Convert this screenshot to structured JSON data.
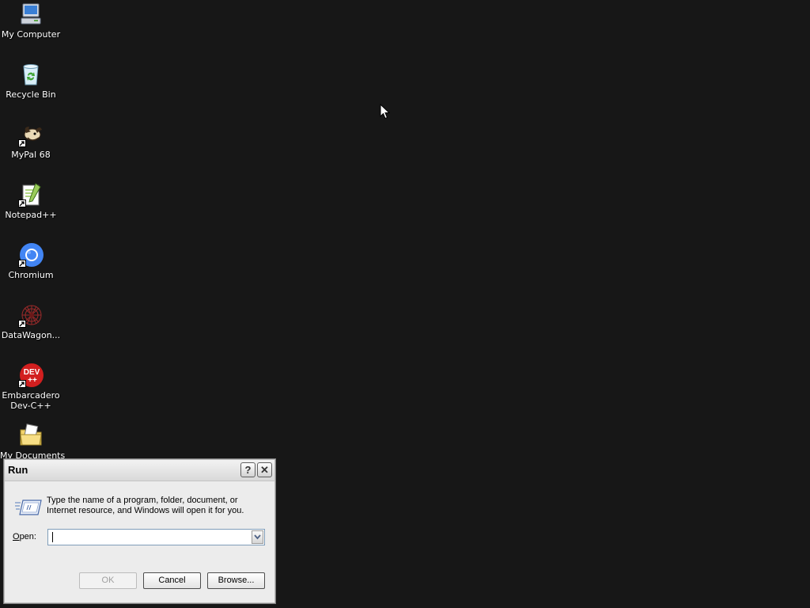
{
  "desktop": {
    "icons": [
      {
        "label": "My Computer",
        "icon": "my-computer-icon"
      },
      {
        "label": "Recycle Bin",
        "icon": "recycle-bin-icon"
      },
      {
        "label": "MyPal 68",
        "icon": "mypal-icon"
      },
      {
        "label": "Notepad++",
        "icon": "notepad-plus-plus-icon"
      },
      {
        "label": "Chromium",
        "icon": "chromium-icon"
      },
      {
        "label": "DataWagon...",
        "icon": "datawagon-icon"
      },
      {
        "label_line1": "Embarcadero",
        "label_line2": "Dev-C++",
        "icon": "dev-cpp-icon",
        "icon_text_top": "DEV",
        "icon_text_bottom": "++"
      },
      {
        "label": "My Documents",
        "icon": "my-documents-icon"
      }
    ]
  },
  "run_dialog": {
    "title": "Run",
    "help_glyph": "?",
    "close_glyph": "✕",
    "description": "Type the name of a program, folder, document, or Internet resource, and Windows will open it for you.",
    "open_label_accel": "O",
    "open_label_rest": "pen:",
    "open_value": "",
    "ok_label": "OK",
    "cancel_label": "Cancel",
    "browse_label": "Browse..."
  },
  "colors": {
    "desktop_background": "#171717",
    "dialog_background": "#ececec",
    "chromium_blue": "#4285f4",
    "dev_cpp_red": "#d21f1f"
  }
}
